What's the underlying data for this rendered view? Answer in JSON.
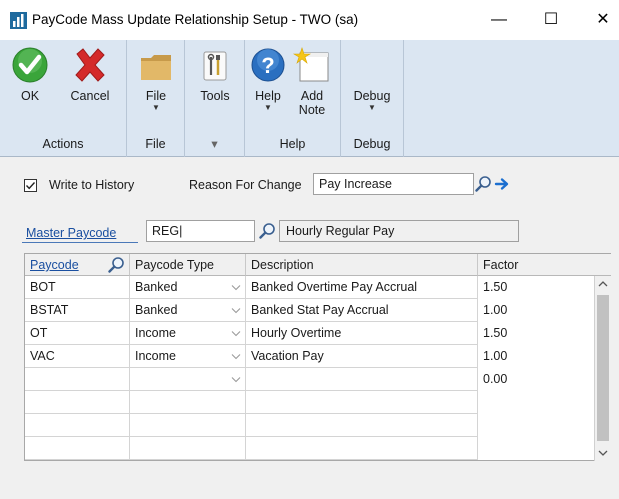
{
  "window": {
    "title": "PayCode Mass Update Relationship Setup  -  TWO (sa)",
    "minimize": "—",
    "maximize": "☐",
    "close": "✕"
  },
  "ribbon": {
    "groups": {
      "actions": "Actions",
      "file": "File",
      "tools": "",
      "help": "Help",
      "debug": "Debug"
    },
    "buttons": {
      "ok": "OK",
      "cancel": "Cancel",
      "file": "File",
      "tools": "Tools",
      "help": "Help",
      "add_note_1": "Add",
      "add_note_2": "Note",
      "debug": "Debug"
    },
    "tools_caret": "▾"
  },
  "form": {
    "write_to_history_label": "Write to History",
    "write_to_history_checked": true,
    "reason_label": "Reason For Change",
    "reason_value": "Pay Increase",
    "master_paycode_label": "Master Paycode",
    "master_paycode_value": "REG|",
    "master_paycode_desc": "Hourly Regular Pay"
  },
  "grid": {
    "columns": [
      "Paycode",
      "Paycode Type",
      "Description",
      "Factor"
    ],
    "rows": [
      {
        "paycode": "BOT",
        "type": "Banked",
        "description": "Banked Overtime Pay Accrual",
        "factor": "1.50"
      },
      {
        "paycode": "BSTAT",
        "type": "Banked",
        "description": "Banked Stat Pay Accrual",
        "factor": "1.00"
      },
      {
        "paycode": "OT",
        "type": "Income",
        "description": "Hourly Overtime",
        "factor": "1.50"
      },
      {
        "paycode": "VAC",
        "type": "Income",
        "description": "Vacation Pay",
        "factor": "1.00"
      },
      {
        "paycode": "",
        "type": "",
        "description": "",
        "factor": "0.00"
      },
      {
        "paycode": "",
        "type": "",
        "description": "",
        "factor": ""
      },
      {
        "paycode": "",
        "type": "",
        "description": "",
        "factor": ""
      },
      {
        "paycode": "",
        "type": "",
        "description": "",
        "factor": ""
      }
    ]
  },
  "colors": {
    "ribbon_bg": "#dbe6f2",
    "link_blue": "#1a4fa0",
    "ok_green": "#3aa53a",
    "cancel_red": "#d42a2a",
    "help_blue": "#2a6fc0"
  }
}
